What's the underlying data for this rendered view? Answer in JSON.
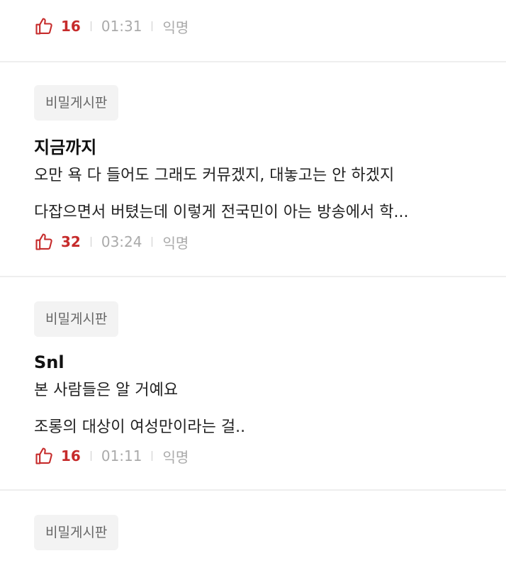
{
  "posts": [
    {
      "board": "",
      "title": "",
      "lines": [],
      "likes": "16",
      "time": "01:31",
      "author": "익명"
    },
    {
      "board": "비밀게시판",
      "title": "지금까지",
      "lines": [
        "오만 욕 다 들어도 그래도 커뮤겠지, 대놓고는 안 하겠지",
        "다잡으면서 버텼는데 이렇게 전국민이 아는 방송에서 학..."
      ],
      "likes": "32",
      "time": "03:24",
      "author": "익명"
    },
    {
      "board": "비밀게시판",
      "title": "Snl",
      "lines": [
        "본 사람들은 알 거예요",
        "조롱의 대상이 여성만이라는 걸.."
      ],
      "likes": "16",
      "time": "01:11",
      "author": "익명"
    },
    {
      "board": "비밀게시판",
      "title": "",
      "lines": [],
      "likes": "",
      "time": "",
      "author": ""
    }
  ],
  "colors": {
    "like": "#c62b2b",
    "meta_gray": "#aaaaaa",
    "tag_bg": "#f3f3f3",
    "divider": "#eeeeee"
  },
  "icons": {
    "like": "thumbs-up-outline-icon"
  }
}
